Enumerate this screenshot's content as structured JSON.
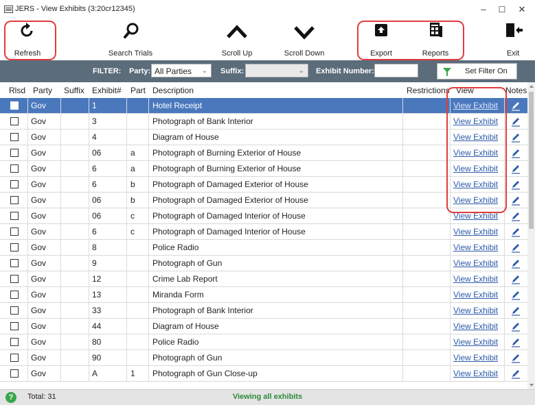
{
  "window": {
    "title": "JERS - View Exhibits (3:20cr12345)",
    "minimize": "–",
    "maximize": "☐",
    "close": "✕"
  },
  "toolbar": {
    "refresh": {
      "label": "Refresh",
      "icon": "refresh-icon"
    },
    "search": {
      "label": "Search Trials",
      "icon": "search-icon"
    },
    "scroll_up": {
      "label": "Scroll Up",
      "icon": "chevron-up-icon"
    },
    "scroll_down": {
      "label": "Scroll Down",
      "icon": "chevron-down-icon"
    },
    "export": {
      "label": "Export",
      "icon": "export-icon"
    },
    "reports": {
      "label": "Reports",
      "icon": "reports-icon"
    },
    "exit": {
      "label": "Exit",
      "icon": "exit-icon"
    }
  },
  "filter": {
    "label": "FILTER:",
    "party_label": "Party:",
    "party_value": "All Parties",
    "suffix_label": "Suffix:",
    "suffix_value": "",
    "exhibit_label": "Exhibit Number:",
    "exhibit_value": "",
    "button": "Set Filter On"
  },
  "table": {
    "headers": [
      "Rlsd",
      "Party",
      "Suffix",
      "Exhibit#",
      "Part",
      "Description",
      "Restrictions",
      "View",
      "Notes"
    ],
    "view_label": "View Exhibit",
    "rows": [
      {
        "party": "Gov",
        "suffix": "",
        "exhibit": "1",
        "part": "",
        "description": "Hotel Receipt",
        "restrictions": "",
        "selected": true
      },
      {
        "party": "Gov",
        "suffix": "",
        "exhibit": "3",
        "part": "",
        "description": "Photograph of Bank Interior",
        "restrictions": ""
      },
      {
        "party": "Gov",
        "suffix": "",
        "exhibit": "4",
        "part": "",
        "description": "Diagram of House",
        "restrictions": ""
      },
      {
        "party": "Gov",
        "suffix": "",
        "exhibit": "06",
        "part": "a",
        "description": "Photograph of Burning Exterior of House",
        "restrictions": ""
      },
      {
        "party": "Gov",
        "suffix": "",
        "exhibit": "6",
        "part": "a",
        "description": "Photograph of Burning Exterior of House",
        "restrictions": ""
      },
      {
        "party": "Gov",
        "suffix": "",
        "exhibit": "6",
        "part": "b",
        "description": "Photograph of Damaged Exterior of House",
        "restrictions": ""
      },
      {
        "party": "Gov",
        "suffix": "",
        "exhibit": "06",
        "part": "b",
        "description": "Photograph of Damaged Exterior of House",
        "restrictions": ""
      },
      {
        "party": "Gov",
        "suffix": "",
        "exhibit": "06",
        "part": "c",
        "description": "Photograph of Damaged Interior of House",
        "restrictions": ""
      },
      {
        "party": "Gov",
        "suffix": "",
        "exhibit": "6",
        "part": "c",
        "description": "Photograph of Damaged Interior of House",
        "restrictions": ""
      },
      {
        "party": "Gov",
        "suffix": "",
        "exhibit": "8",
        "part": "",
        "description": "Police Radio",
        "restrictions": ""
      },
      {
        "party": "Gov",
        "suffix": "",
        "exhibit": "9",
        "part": "",
        "description": "Photograph of Gun",
        "restrictions": ""
      },
      {
        "party": "Gov",
        "suffix": "",
        "exhibit": "12",
        "part": "",
        "description": "Crime Lab Report",
        "restrictions": ""
      },
      {
        "party": "Gov",
        "suffix": "",
        "exhibit": "13",
        "part": "",
        "description": "Miranda Form",
        "restrictions": ""
      },
      {
        "party": "Gov",
        "suffix": "",
        "exhibit": "33",
        "part": "",
        "description": "Photograph of Bank Interior",
        "restrictions": ""
      },
      {
        "party": "Gov",
        "suffix": "",
        "exhibit": "44",
        "part": "",
        "description": "Diagram of House",
        "restrictions": ""
      },
      {
        "party": "Gov",
        "suffix": "",
        "exhibit": "80",
        "part": "",
        "description": "Police Radio",
        "restrictions": ""
      },
      {
        "party": "Gov",
        "suffix": "",
        "exhibit": "90",
        "part": "",
        "description": "Photograph of Gun",
        "restrictions": ""
      },
      {
        "party": "Gov",
        "suffix": "",
        "exhibit": "A",
        "part": "1",
        "description": "Photograph of Gun Close-up",
        "restrictions": ""
      }
    ]
  },
  "status": {
    "help": "?",
    "total": "Total: 31",
    "message": "Viewing all exhibits"
  },
  "colors": {
    "filter_bg": "#5b6c7b",
    "selected_row": "#4a78bd",
    "highlight": "#e23b3b",
    "status_green": "#2d8a3a"
  }
}
